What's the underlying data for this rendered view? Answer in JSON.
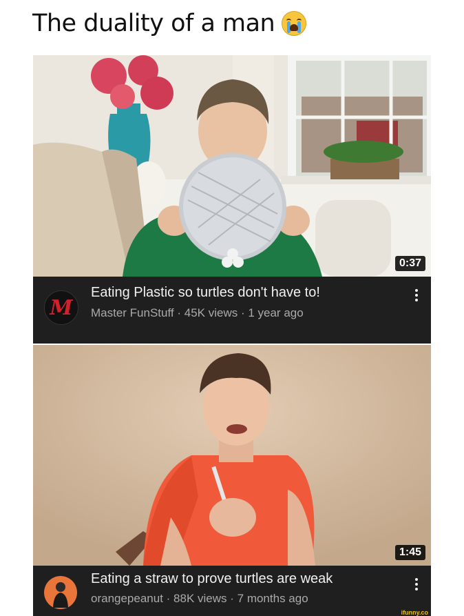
{
  "meme": {
    "title": "The duality of a man",
    "emoji": "loudly-crying-face-icon"
  },
  "videos": [
    {
      "duration": "0:37",
      "title": "Eating Plastic so turtles don't have to!",
      "channel": "Master FunStuff",
      "views": "45K views",
      "age": "1 year ago",
      "separator": " · ",
      "avatar_letter": "M"
    },
    {
      "duration": "1:45",
      "title": "Eating a straw to prove turtles are weak",
      "channel": "orangepeanut",
      "views": "88K views",
      "age": "7 months ago",
      "separator": " · "
    }
  ],
  "watermark": "ifunny.co",
  "colors": {
    "meta_background": "#1f1f1f",
    "title_text": "#f1f1f1",
    "subtitle_text": "#aaaaaa",
    "avatar1_mark": "#d3202a",
    "avatar2_background": "#e9753a"
  }
}
